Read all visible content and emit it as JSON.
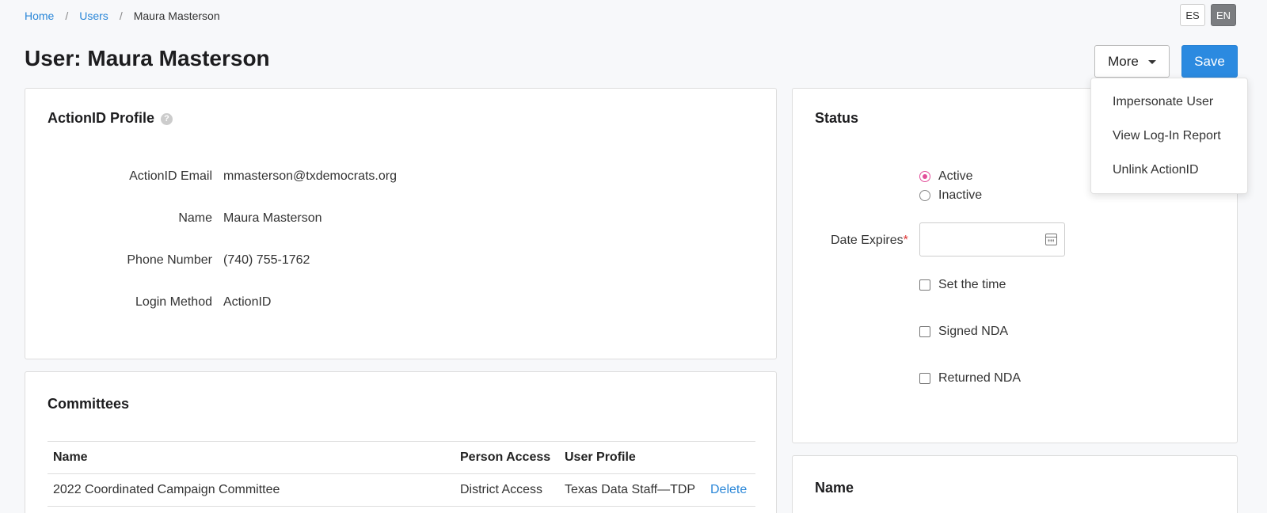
{
  "breadcrumb": {
    "home": "Home",
    "users": "Users",
    "current": "Maura Masterson",
    "sep": "/"
  },
  "lang": {
    "es": "ES",
    "en": "EN"
  },
  "page_title": "User: Maura Masterson",
  "toolbar": {
    "more_label": "More",
    "save_label": "Save"
  },
  "more_menu": {
    "items": [
      "Impersonate User",
      "View Log-In Report",
      "Unlink ActionID"
    ]
  },
  "profile": {
    "title": "ActionID Profile",
    "help": "?",
    "fields": [
      {
        "label": "ActionID Email",
        "value": "mmasterson@txdemocrats.org"
      },
      {
        "label": "Name",
        "value": "Maura Masterson"
      },
      {
        "label": "Phone Number",
        "value": "(740) 755-1762"
      },
      {
        "label": "Login Method",
        "value": "ActionID"
      }
    ]
  },
  "committees": {
    "title": "Committees",
    "headers": [
      "Name",
      "Person Access",
      "User Profile",
      ""
    ],
    "rows": [
      {
        "name": "2022 Coordinated Campaign Committee",
        "access": "District Access",
        "profile": "Texas Data Staff—TDP",
        "action": "Delete"
      }
    ]
  },
  "status": {
    "title": "Status",
    "options": [
      "Active",
      "Inactive"
    ],
    "selected": "Active",
    "date_label": "Date Expires",
    "required_mark": "*",
    "date_value": "",
    "checkboxes": [
      "Set the time",
      "Signed NDA",
      "Returned NDA"
    ]
  },
  "name_section": {
    "title": "Name"
  },
  "colors": {
    "link": "#2b87d8",
    "primary": "#2b8ae0",
    "radio_active": "#e24e9a",
    "required": "#dd3333"
  },
  "icons": {
    "help": "help-icon",
    "calendar": "calendar-icon",
    "caret": "caret-down-icon"
  }
}
